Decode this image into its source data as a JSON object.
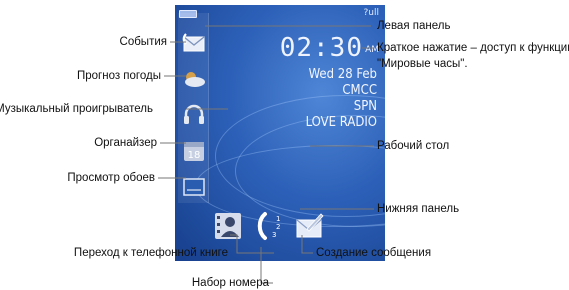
{
  "status": {
    "signal_label": "?ull"
  },
  "clock": {
    "time": "02:30",
    "ampm": "AM"
  },
  "info": {
    "date": "Wed 28 Feb",
    "operator": "CMCC",
    "network": "SPN",
    "radio": "LOVE RADIO"
  },
  "organizer_icon_day": "18",
  "callouts_left": {
    "events": "События",
    "weather": "Прогноз погоды",
    "music": "Музыкальный проигрыватель",
    "organizer": "Органайзер",
    "wallpaper": "Просмотр обоев",
    "phonebook": "Переход к телефонной книге",
    "dial": "Набор номера"
  },
  "callouts_right": {
    "left_panel": "Левая панель",
    "short_press_line1": "Краткое нажатие – доступ к функции",
    "short_press_line2": "\"Мировые часы\".",
    "desktop": "Рабочий стол",
    "bottom_panel": "Нижняя панель",
    "new_message": "Создание сообщения"
  },
  "icons": [
    "mail-icon",
    "weather-icon",
    "headphones-icon",
    "calendar-icon",
    "wallpaper-icon",
    "contacts-icon",
    "dial-icon",
    "compose-message-icon"
  ],
  "colors": {
    "screen_blue": "#2c60b8",
    "line": "#777777"
  }
}
